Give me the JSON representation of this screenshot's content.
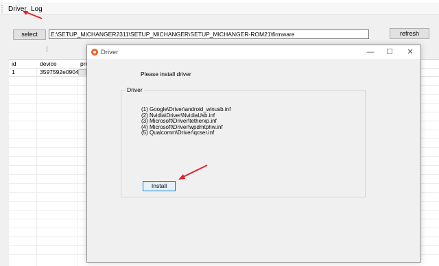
{
  "menu": {
    "driver_label": "Driver",
    "log_label": "Log"
  },
  "toolbar": {
    "select_label": "select",
    "path_value": "E:\\SETUP_MICHANGER2311\\SETUP_MICHANGER\\SETUP_MICHANGER-ROM21\\firmware",
    "refresh_label": "refresh"
  },
  "grid": {
    "columns": [
      "id",
      "device",
      "pro"
    ],
    "rows": [
      {
        "id": "1",
        "device": "3597592e0904"
      }
    ]
  },
  "dialog": {
    "title": "Driver",
    "message": "Please install driver",
    "group_label": "Driver",
    "drivers": [
      "(1) Google\\Driver\\android_winusb.inf",
      "(2) Nvidia\\Driver\\NvidiaUsb.inf",
      "(3) Microsoft\\Driver\\tetherxp.inf",
      "(4) Microsoft\\Driver\\wpdmtphw.inf",
      "(5) Qualcomm\\Driver\\qcser.inf"
    ],
    "install_label": "Install",
    "minimize_glyph": "—",
    "maximize_glyph": "☐",
    "close_glyph": "✕"
  },
  "colors": {
    "annotation_arrow": "#e8202a",
    "app_icon": "#e8632a",
    "button_focus_border": "#0078d7"
  }
}
